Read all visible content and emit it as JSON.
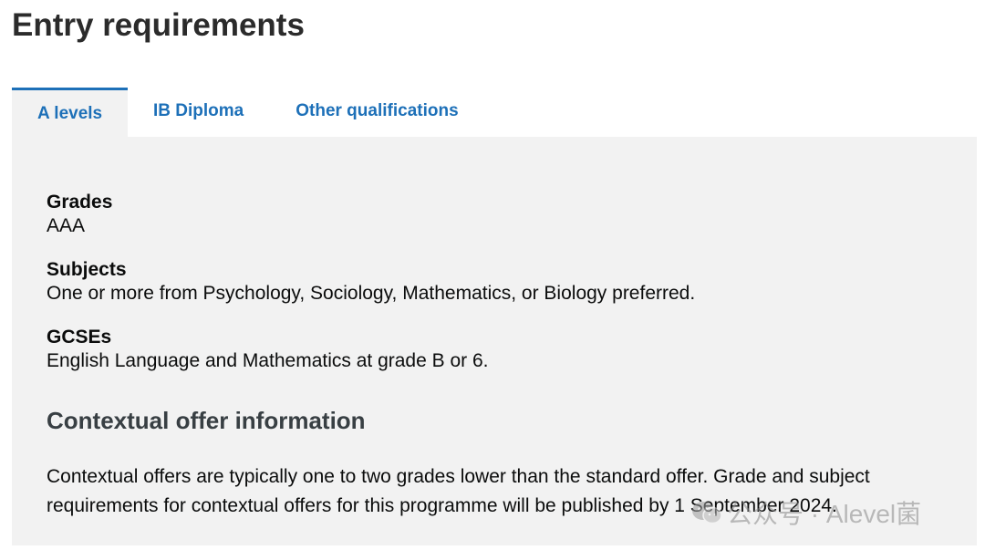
{
  "page_title": "Entry requirements",
  "tabs": [
    {
      "label": "A levels",
      "active": true
    },
    {
      "label": "IB Diploma",
      "active": false
    },
    {
      "label": "Other qualifications",
      "active": false
    }
  ],
  "requirements": {
    "grades": {
      "label": "Grades",
      "value": "AAA"
    },
    "subjects": {
      "label": "Subjects",
      "value": "One or more from Psychology, Sociology, Mathematics, or Biology preferred."
    },
    "gcses": {
      "label": "GCSEs",
      "value": "English Language and Mathematics at grade B or 6."
    }
  },
  "contextual": {
    "heading": "Contextual offer information",
    "body": "Contextual offers are typically one to two grades lower than the standard offer. Grade and subject requirements for contextual offers for this programme will be published by 1 September 2024."
  },
  "watermark": {
    "icon": "wechat-icon",
    "text": "公众号 · Alevel菌"
  },
  "colors": {
    "link": "#1d70b8",
    "panel_bg": "#f2f2f2",
    "heading": "#2b2b2b"
  }
}
